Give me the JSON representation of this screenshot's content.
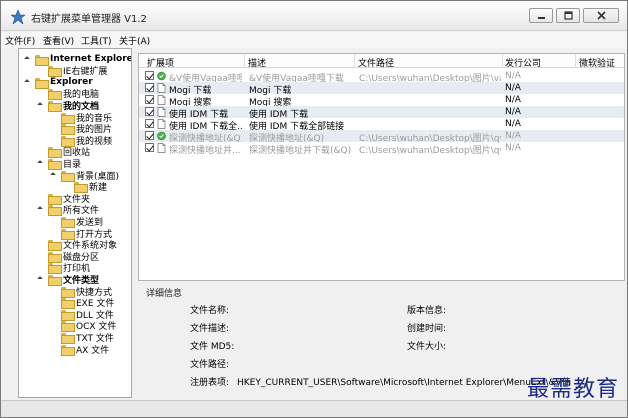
{
  "window": {
    "title": "右键扩展菜单管理器 V1.2",
    "buttons": {
      "minimize": "—",
      "maximize": "□",
      "close": "✕"
    }
  },
  "menu": [
    "文件(F)",
    "查看(V)",
    "工具(T)",
    "关于(A)"
  ],
  "tree": [
    {
      "label": "Internet Explorer",
      "bold": true,
      "level": 0,
      "expanded": true
    },
    {
      "label": "IE右键扩展",
      "bold": false,
      "level": 1
    },
    {
      "label": "Explorer",
      "bold": true,
      "level": 0,
      "expanded": true
    },
    {
      "label": "我的电脑",
      "bold": false,
      "level": 1
    },
    {
      "label": "我的文档",
      "bold": true,
      "level": 1,
      "expanded": true
    },
    {
      "label": "我的音乐",
      "bold": false,
      "level": 2
    },
    {
      "label": "我的图片",
      "bold": false,
      "level": 2
    },
    {
      "label": "我的视频",
      "bold": false,
      "level": 2
    },
    {
      "label": "回收站",
      "bold": false,
      "level": 1
    },
    {
      "label": "目录",
      "bold": false,
      "level": 1,
      "expanded": true
    },
    {
      "label": "背景(桌面)",
      "bold": false,
      "level": 2,
      "expanded": true
    },
    {
      "label": "新建",
      "bold": false,
      "level": 3
    },
    {
      "label": "文件夹",
      "bold": false,
      "level": 1
    },
    {
      "label": "所有文件",
      "bold": false,
      "level": 1,
      "expanded": true
    },
    {
      "label": "发送到",
      "bold": false,
      "level": 2
    },
    {
      "label": "打开方式",
      "bold": false,
      "level": 2
    },
    {
      "label": "文件系统对象",
      "bold": false,
      "level": 1
    },
    {
      "label": "磁盘分区",
      "bold": false,
      "level": 1
    },
    {
      "label": "打印机",
      "bold": false,
      "level": 1
    },
    {
      "label": "文件类型",
      "bold": true,
      "level": 1,
      "expanded": true
    },
    {
      "label": "快捷方式",
      "bold": false,
      "level": 2
    },
    {
      "label": "EXE 文件",
      "bold": false,
      "level": 2
    },
    {
      "label": "DLL 文件",
      "bold": false,
      "level": 2
    },
    {
      "label": "OCX 文件",
      "bold": false,
      "level": 2
    },
    {
      "label": "TXT 文件",
      "bold": false,
      "level": 2
    },
    {
      "label": "AX 文件",
      "bold": false,
      "level": 2
    }
  ],
  "grid": {
    "columns": [
      "扩展项",
      "描述",
      "文件路径",
      "发行公司",
      "微软验证"
    ],
    "rows": [
      {
        "name": "&V使用Vagaa哇嘎...",
        "desc": "&V使用Vagaa哇嘎下载",
        "path": "C:\\Users\\wuhan\\Desktop\\图片\\vag...",
        "company": "N/A",
        "verify": "",
        "dim": true,
        "icon": "green"
      },
      {
        "name": "Mogi 下载",
        "desc": "Mogi 下载",
        "path": "",
        "company": "N/A",
        "verify": "",
        "dim": false,
        "icon": "doc"
      },
      {
        "name": "Mogi 搜索",
        "desc": "Mogi 搜索",
        "path": "",
        "company": "N/A",
        "verify": "",
        "dim": false,
        "icon": "doc"
      },
      {
        "name": "使用 IDM 下载",
        "desc": "使用 IDM 下载",
        "path": "",
        "company": "N/A",
        "verify": "",
        "dim": false,
        "icon": "doc"
      },
      {
        "name": "使用 IDM 下载全...",
        "desc": "使用 IDM 下载全部链接",
        "path": "",
        "company": "N/A",
        "verify": "",
        "dim": false,
        "icon": "doc"
      },
      {
        "name": "探测快播地址(&Q)",
        "desc": "探测快播地址(&Q)",
        "path": "C:\\Users\\wuhan\\Desktop\\图片\\qvo...",
        "company": "N/A",
        "verify": "",
        "dim": true,
        "icon": "green"
      },
      {
        "name": "探测快播地址并...",
        "desc": "探测快播地址并下载(&Q)",
        "path": "C:\\Users\\wuhan\\Desktop\\图片\\qvo...",
        "company": "N/A",
        "verify": "",
        "dim": true,
        "icon": "doc"
      }
    ]
  },
  "details": {
    "title": "详细信息",
    "file_name": "文件名称:",
    "file_desc": "文件描述:",
    "file_md5": "文件 MD5:",
    "file_path": "文件路径:",
    "registry_label": "注册表项:",
    "registry_value": "HKEY_CURRENT_USER\\Software\\Microsoft\\Internet Explorer\\MenuExt\\&V使",
    "version": "版本信息:",
    "created": "创建时间:",
    "size": "文件大小:"
  },
  "watermark": "最需教育",
  "colors": {
    "folder": "#f1cf6a",
    "selection": "#e7ecf2",
    "watermark": "#1c2a85"
  }
}
